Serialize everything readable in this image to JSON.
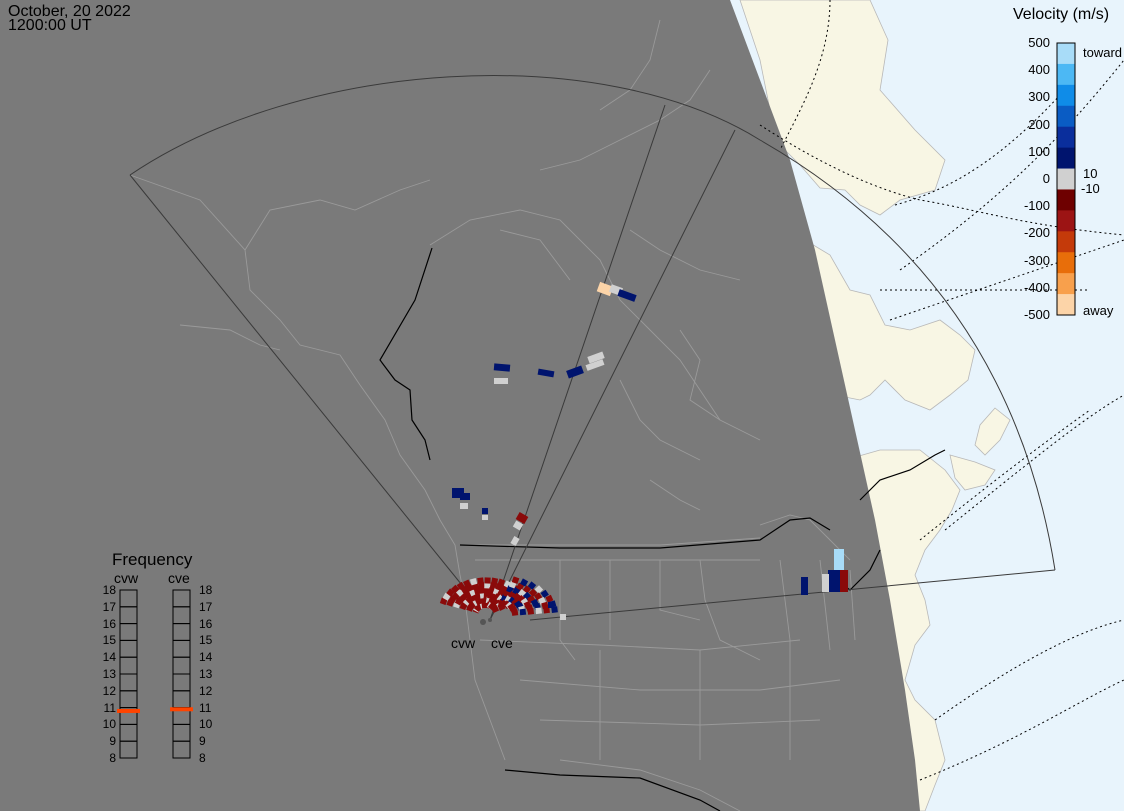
{
  "header": {
    "date": "October, 20 2022",
    "time": "1200:00 UT"
  },
  "velocity_scale": {
    "title": "Velocity (m/s)",
    "ticks": [
      "500",
      "400",
      "300",
      "200",
      "100",
      "0",
      "-100",
      "-200",
      "-300",
      "-400",
      "-500"
    ],
    "toward_label": "toward",
    "away_label": "away",
    "threshold_pos": "10",
    "threshold_neg": "-10",
    "colors": [
      "#a8dcf8",
      "#4cb8f4",
      "#0f8ce8",
      "#0a5cc4",
      "#0a2e9c",
      "#00146e",
      "#d0d0d0",
      "#6e0000",
      "#9c1414",
      "#c43a0a",
      "#e86e0a",
      "#f8a04c",
      "#fcd4a8"
    ]
  },
  "frequency": {
    "title": "Frequency",
    "radars": [
      "cvw",
      "cve"
    ],
    "ticks": [
      "18",
      "17",
      "16",
      "15",
      "14",
      "13",
      "12",
      "11",
      "10",
      "9",
      "8"
    ],
    "values": [
      10.8,
      10.9
    ],
    "marker_color": "#ff4400"
  },
  "radar_sites": [
    "cvw",
    "cve"
  ],
  "colors": {
    "night": "#7a7a7a",
    "day_land": "#f8f6e4",
    "ocean_day": "#e8f4fc",
    "border_night": "#9a9a9a",
    "border_day": "#b8b8b8",
    "fov": "#3a3a3a"
  }
}
